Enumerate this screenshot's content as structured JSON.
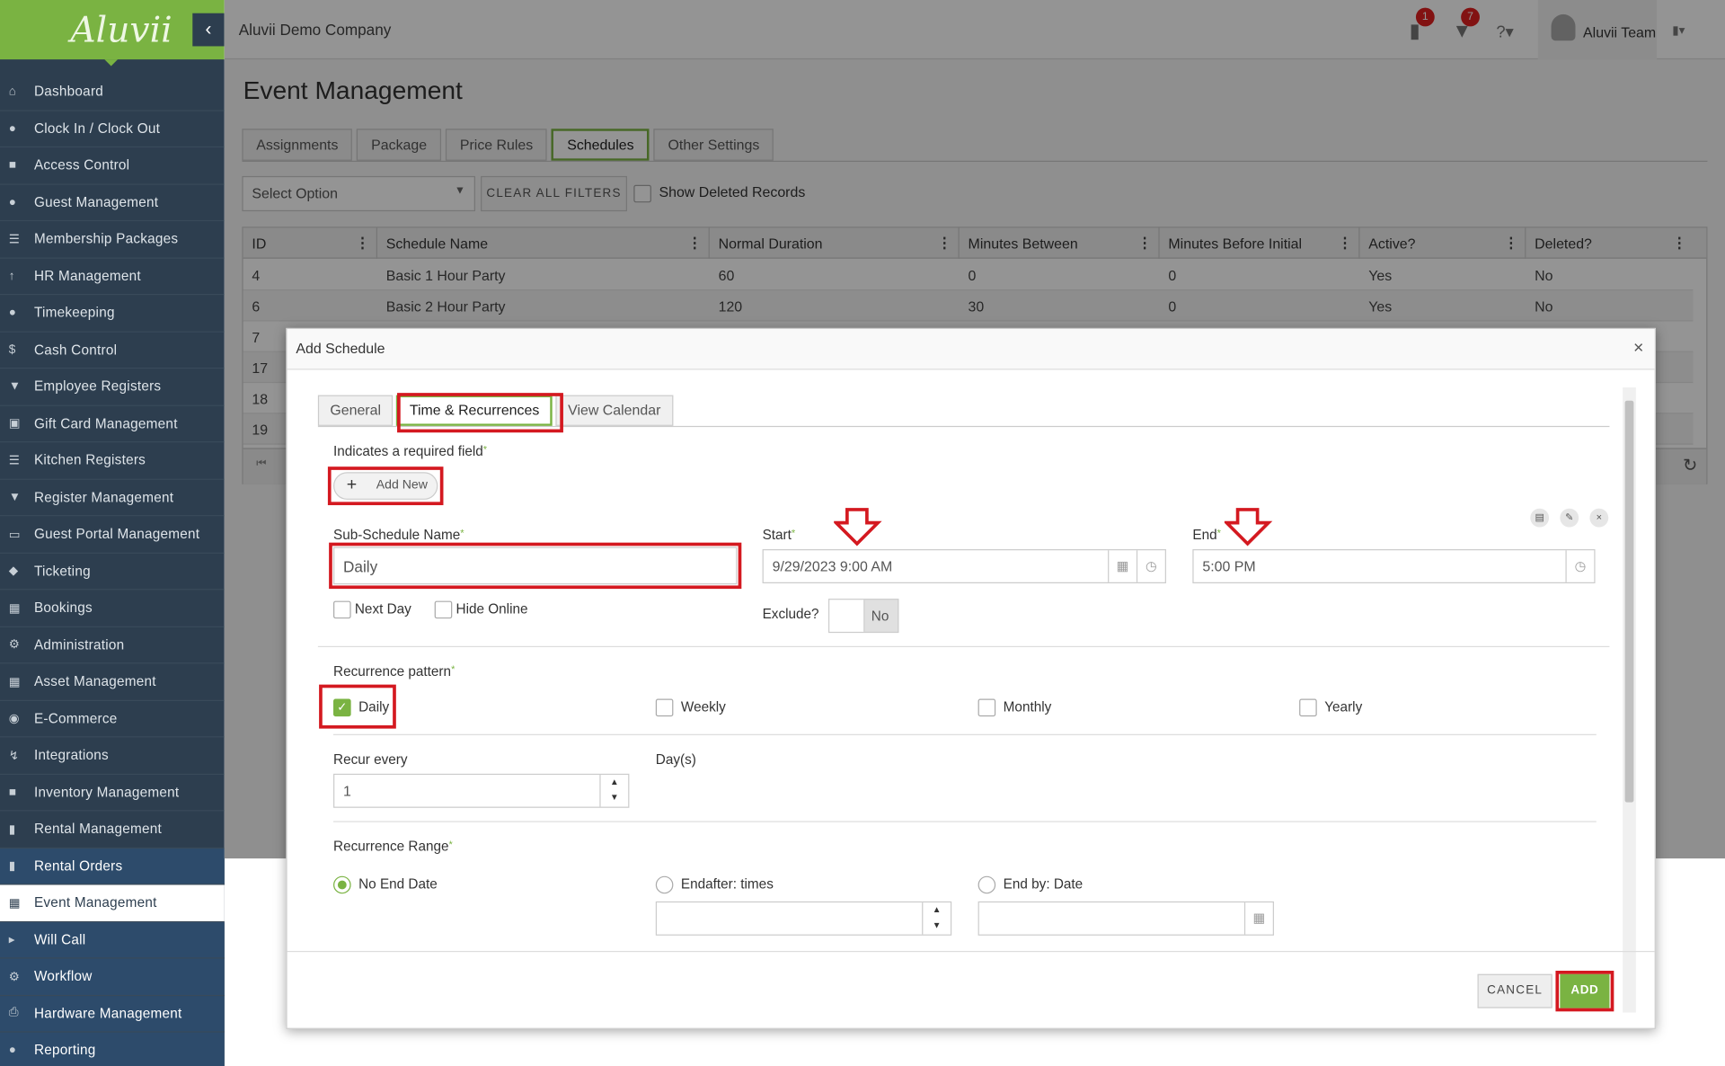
{
  "app": {
    "logo": "Aluvii",
    "company": "Aluvii Demo Company",
    "user": "Aluvii Team",
    "badges": {
      "notifications": "1",
      "cart": "7"
    }
  },
  "sidebar": {
    "items": [
      {
        "label": "Dashboard",
        "icon": "home-icon"
      },
      {
        "label": "Clock In / Clock Out",
        "icon": "clock-icon"
      },
      {
        "label": "Access Control",
        "icon": "lock-icon"
      },
      {
        "label": "Guest Management",
        "icon": "users-icon"
      },
      {
        "label": "Membership Packages",
        "icon": "list-icon"
      },
      {
        "label": "HR Management",
        "icon": "user-icon"
      },
      {
        "label": "Timekeeping",
        "icon": "clock-icon"
      },
      {
        "label": "Cash Control",
        "icon": "dollar-icon"
      },
      {
        "label": "Employee Registers",
        "icon": "cart-icon"
      },
      {
        "label": "Gift Card Management",
        "icon": "gift-icon"
      },
      {
        "label": "Kitchen Registers",
        "icon": "list-icon"
      },
      {
        "label": "Register Management",
        "icon": "cart-icon"
      },
      {
        "label": "Guest Portal Management",
        "icon": "monitor-icon"
      },
      {
        "label": "Ticketing",
        "icon": "ticket-icon"
      },
      {
        "label": "Bookings",
        "icon": "calendar-icon"
      },
      {
        "label": "Administration",
        "icon": "gears-icon"
      },
      {
        "label": "Asset Management",
        "icon": "cubes-icon"
      },
      {
        "label": "E-Commerce",
        "icon": "globe-icon"
      },
      {
        "label": "Integrations",
        "icon": "bolt-icon"
      },
      {
        "label": "Inventory Management",
        "icon": "box-icon"
      },
      {
        "label": "Rental Management",
        "icon": "clipboard-icon"
      },
      {
        "label": "Rental Orders",
        "icon": "file-icon"
      },
      {
        "label": "Event Management",
        "icon": "calendar-check-icon"
      },
      {
        "label": "Will Call",
        "icon": "megaphone-icon"
      },
      {
        "label": "Workflow",
        "icon": "gear-icon"
      },
      {
        "label": "Hardware Management",
        "icon": "printer-icon"
      },
      {
        "label": "Reporting",
        "icon": "pin-icon"
      }
    ]
  },
  "page": {
    "title": "Event Management",
    "tabs": [
      "Assignments",
      "Package",
      "Price Rules",
      "Schedules",
      "Other Settings"
    ],
    "filter": {
      "select_placeholder": "Select Option",
      "clear_label": "CLEAR ALL FILTERS",
      "show_deleted_label": "Show Deleted Records"
    },
    "grid": {
      "columns": [
        "ID",
        "Schedule Name",
        "Normal Duration",
        "Minutes Between",
        "Minutes Before Initial",
        "Active?",
        "Deleted?"
      ],
      "rows": [
        [
          "4",
          "Basic 1 Hour Party",
          "60",
          "0",
          "0",
          "Yes",
          "No"
        ],
        [
          "6",
          "Basic 2 Hour Party",
          "120",
          "30",
          "0",
          "Yes",
          "No"
        ],
        [
          "7",
          "",
          "",
          "",
          "",
          "",
          ""
        ],
        [
          "17",
          "",
          "",
          "",
          "",
          "",
          ""
        ],
        [
          "18",
          "",
          "",
          "",
          "",
          "",
          ""
        ],
        [
          "19",
          "",
          "",
          "",
          "",
          "",
          ""
        ]
      ]
    }
  },
  "modal": {
    "title": "Add Schedule",
    "tabs": [
      "General",
      "Time & Recurrences",
      "View Calendar"
    ],
    "required_note": "Indicates a required field",
    "add_new_label": "Add New",
    "sub_schedule_label": "Sub-Schedule Name",
    "sub_schedule_value": "Daily",
    "next_day_label": "Next Day",
    "hide_online_label": "Hide Online",
    "start_label": "Start",
    "start_value": "9/29/2023 9:00 AM",
    "end_label": "End",
    "end_value": "5:00 PM",
    "exclude_label": "Exclude?",
    "exclude_value": "No",
    "recurrence_label": "Recurrence pattern",
    "patterns": [
      {
        "label": "Daily",
        "checked": true
      },
      {
        "label": "Weekly",
        "checked": false
      },
      {
        "label": "Monthly",
        "checked": false
      },
      {
        "label": "Yearly",
        "checked": false
      }
    ],
    "recur_every_label": "Recur every",
    "recur_every_value": "1",
    "recur_unit": "Day(s)",
    "range_label": "Recurrence Range",
    "range_options": [
      "No End Date",
      "Endafter: times",
      "End by: Date"
    ],
    "cancel_label": "CANCEL",
    "add_label": "ADD"
  },
  "colors": {
    "brand_green": "#7ab342",
    "sidebar_bg": "#2d3e4f",
    "highlight_red": "#d41920"
  }
}
